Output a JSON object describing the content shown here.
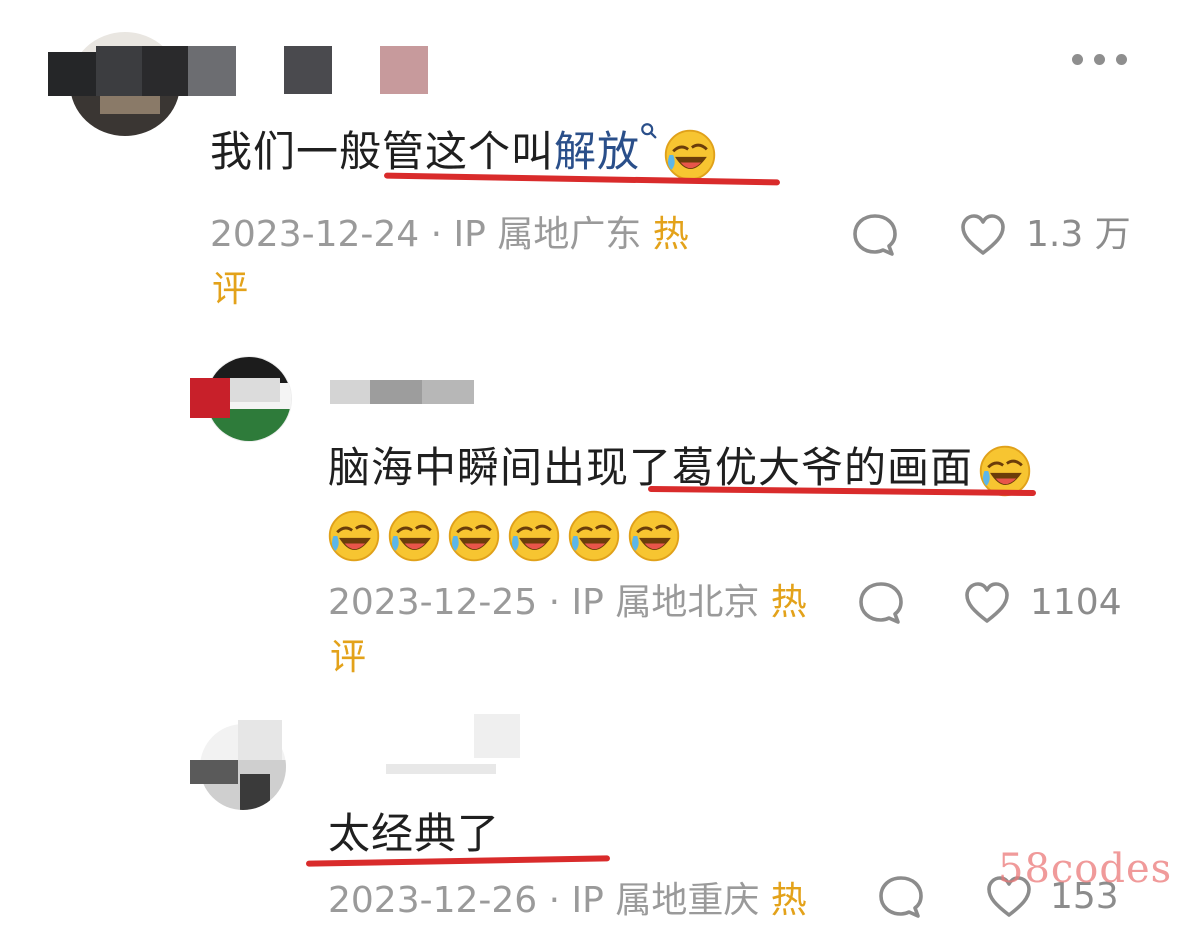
{
  "comments": [
    {
      "text_prefix": "我们一般管这个叫",
      "topic_link": "解放",
      "emoji": "cry-laugh",
      "emoji_count": 1,
      "date": "2023-12-24",
      "location": "· IP 属地广东",
      "hot_label_1": "热",
      "hot_label_2": "评",
      "likes": "1.3 万"
    },
    {
      "text": "脑海中瞬间出现了葛优大爷的画面",
      "emoji": "cry-laugh",
      "emoji_count_line1": 1,
      "emoji_count_line2": 6,
      "date": "2023-12-25",
      "location": "· IP 属地北京",
      "hot_label_1": "热",
      "hot_label_2": "评",
      "likes": "1104"
    },
    {
      "text": "太经典了",
      "date": "2023-12-26",
      "location": "· IP 属地重庆",
      "hot_label_1": "热",
      "likes": "153"
    }
  ],
  "icons": {
    "reply": "speech-bubble-icon",
    "like": "heart-icon",
    "more": "more-dots-icon",
    "search": "search-icon"
  },
  "colors": {
    "topic_link": "#2a4f8a",
    "hot_label": "#e3a21a",
    "underline": "#d92b2b",
    "meta_text": "#9a9a9a"
  },
  "watermark": "58codes"
}
